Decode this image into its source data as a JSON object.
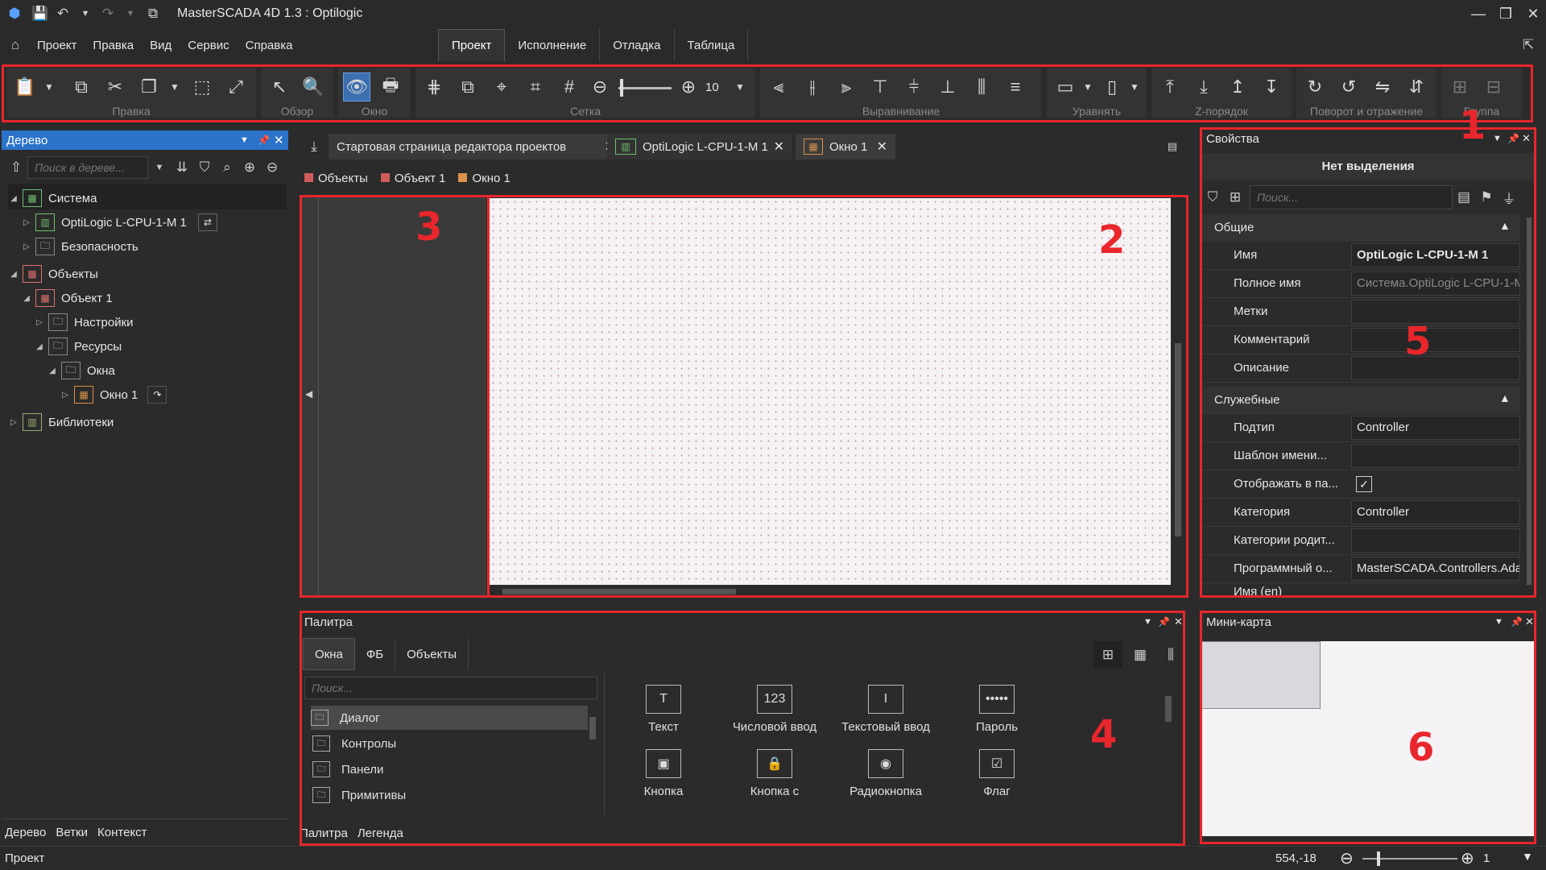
{
  "titlebar": {
    "title": "MasterSCADA 4D 1.3 :  Optilogic"
  },
  "menu": [
    "Проект",
    "Правка",
    "Вид",
    "Сервис",
    "Справка"
  ],
  "ribbon_tabs": [
    "Проект",
    "Исполнение",
    "Отладка",
    "Таблица"
  ],
  "ribbon_groups": [
    "Правка",
    "Обзор",
    "Окно",
    "Сетка",
    "Выравнивание",
    "Уравнять",
    "Z-порядок",
    "Поворот и отражение",
    "Группа"
  ],
  "grid_value": "10",
  "tree": {
    "title": "Дерево",
    "search_placeholder": "Поиск в дереве...",
    "items": [
      "Система",
      "OptiLogic L-CPU-1-M 1",
      "Безопасность",
      "Объекты",
      "Объект 1",
      "Настройки",
      "Ресурсы",
      "Окна",
      "Окно 1",
      "Библиотеки"
    ],
    "bottom_tabs": [
      "Дерево",
      "Ветки",
      "Контекст"
    ]
  },
  "doc_tabs": [
    "Стартовая страница редактора проектов",
    "OptiLogic L-CPU-1-M 1",
    "Окно 1"
  ],
  "breadcrumb": [
    "Объекты",
    "Объект 1",
    "Окно 1"
  ],
  "properties": {
    "title": "Свойства",
    "selection": "Нет выделения",
    "search_placeholder": "Поиск...",
    "sections": [
      "Общие",
      "Служебные"
    ],
    "general": [
      {
        "name": "Имя",
        "value": "OptiLogic L-CPU-1-M 1"
      },
      {
        "name": "Полное имя",
        "value": "Система.OptiLogic L-CPU-1-M"
      },
      {
        "name": "Метки",
        "value": ""
      },
      {
        "name": "Комментарий",
        "value": ""
      },
      {
        "name": "Описание",
        "value": ""
      }
    ],
    "service": [
      {
        "name": "Подтип",
        "value": "Controller"
      },
      {
        "name": "Шаблон имени...",
        "value": ""
      },
      {
        "name": "Отображать в па...",
        "value": "✓"
      },
      {
        "name": "Категория",
        "value": "Controller"
      },
      {
        "name": "Категории родит...",
        "value": ""
      },
      {
        "name": "Программный о...",
        "value": "MasterSCADA.Controllers.Ada"
      },
      {
        "name": "Имя (en)",
        "value": ""
      }
    ]
  },
  "palette": {
    "title": "Палитра",
    "tabs": [
      "Окна",
      "ФБ",
      "Объекты"
    ],
    "search_placeholder": "Поиск...",
    "list": [
      "Диалог",
      "Контролы",
      "Панели",
      "Примитивы"
    ],
    "items": [
      {
        "label": "Текст",
        "icon": "T"
      },
      {
        "label": "Числовой ввод",
        "icon": "123"
      },
      {
        "label": "Текстовый ввод",
        "icon": "I"
      },
      {
        "label": "Пароль",
        "icon": "•••••"
      },
      {
        "label": "Кнопка",
        "icon": "▣"
      },
      {
        "label": "Кнопка с фиксацией",
        "icon": "🔒"
      },
      {
        "label": "Радиокнопка",
        "icon": "◉"
      },
      {
        "label": "Флаг",
        "icon": "☑"
      }
    ],
    "bottom_tabs": [
      "Палитра",
      "Легенда"
    ]
  },
  "minimap": {
    "title": "Мини-карта"
  },
  "status": {
    "left": "Проект",
    "coords": "554,-18",
    "zoom": "1"
  },
  "markers": [
    "1",
    "2",
    "3",
    "4",
    "5",
    "6"
  ],
  "colors": {
    "accent": "#3b6fb0",
    "annotation": "#e8262c"
  }
}
